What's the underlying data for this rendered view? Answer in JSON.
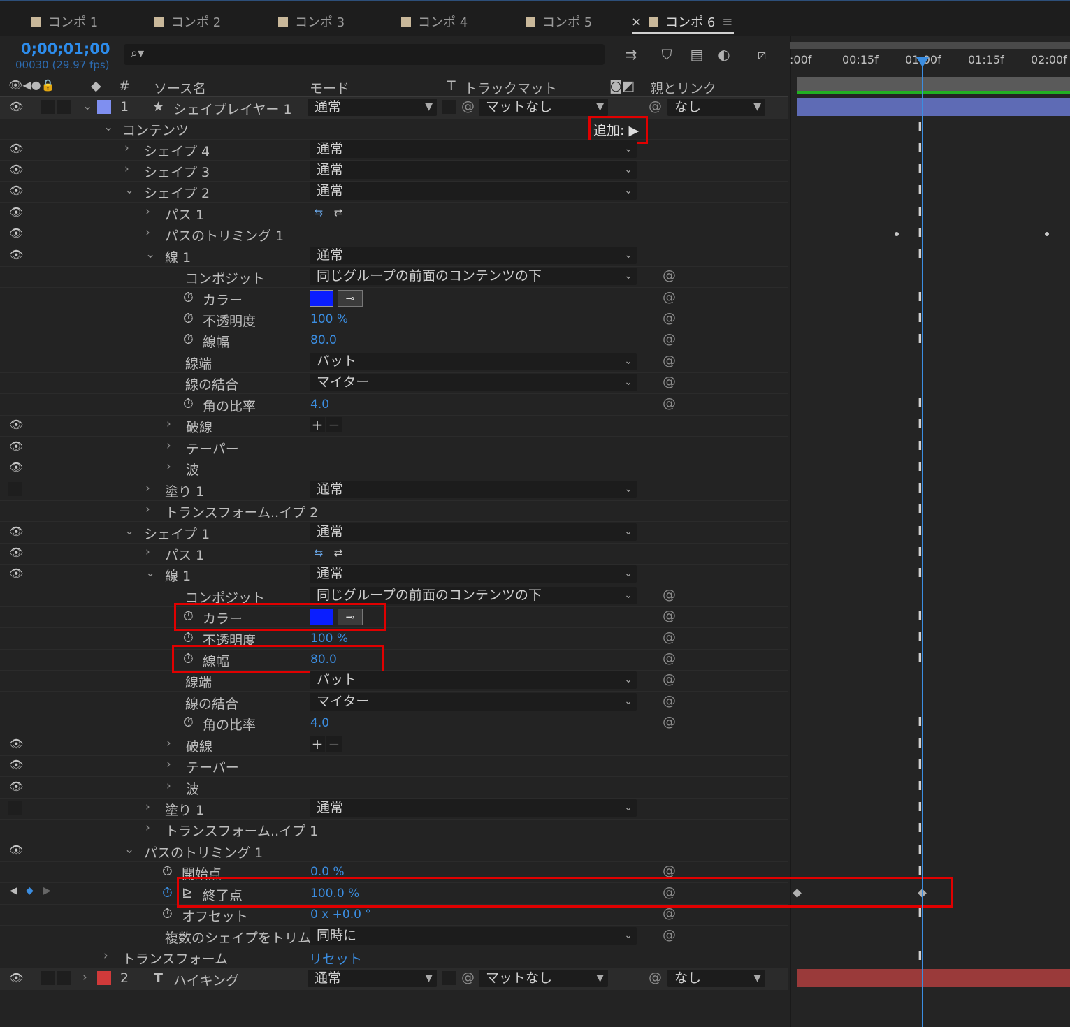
{
  "tabs": [
    "コンポ 1",
    "コンポ 2",
    "コンポ 3",
    "コンポ 4",
    "コンポ 5",
    "コンポ 6"
  ],
  "active_tab_close": "×",
  "menu_icon": "≡",
  "timecode": "0;00;01;00",
  "fps": "00030 (29.97 fps)",
  "search": {
    "icon": "search-icon",
    "placeholder": ""
  },
  "columns": {
    "hash": "#",
    "source": "ソース名",
    "mode": "モード",
    "t": "T",
    "trackmatte": "トラックマット",
    "parent": "親とリンク"
  },
  "timeline": {
    "ticks": [
      ":00f",
      "00:15f",
      "01:00f",
      "01:15f",
      "02:00f"
    ],
    "current_time": "01:00f",
    "layer1_bar_color": "#5e6bb5",
    "layer2_bar_color": "#9a3a3a"
  },
  "layer1": {
    "num": "1",
    "name": "シェイプレイヤー 1",
    "mode": "通常",
    "matte": "マットなし",
    "parent": "なし",
    "color": "#7f8ff0"
  },
  "layer2": {
    "num": "2",
    "name": "ハイキング",
    "mode": "通常",
    "matte": "マットなし",
    "parent": "なし",
    "color": "#d03a3a"
  },
  "rows": {
    "contents": "コンテンツ",
    "add": "追加:",
    "shape4": "シェイプ 4",
    "shape3": "シェイプ 3",
    "shape2": "シェイプ 2",
    "path1": "パス 1",
    "trim1": "パスのトリミング 1",
    "stroke1": "線 1",
    "composite": "コンポジット",
    "composite_val": "同じグループの前面のコンテンツの下",
    "color": "カラー",
    "opacity": "不透明度",
    "opacity_val": "100 %",
    "width": "線幅",
    "width_val": "80.0",
    "cap": "線端",
    "cap_val": "バット",
    "join": "線の結合",
    "join_val": "マイター",
    "miter": "角の比率",
    "miter_val": "4.0",
    "dashes": "破線",
    "taper": "テーパー",
    "wave": "波",
    "fill1": "塗り 1",
    "transform_shape2": "トランスフォーム..イプ 2",
    "shape1": "シェイプ 1",
    "transform_shape1": "トランスフォーム..イプ 1",
    "trim_start": "開始点",
    "trim_start_val": "0.0 %",
    "trim_end": "終了点",
    "trim_end_val": "100.0 %",
    "trim_offset": "オフセット",
    "trim_offset_val": "0 x +0.0 °",
    "trim_multi": "複数のシェイプをトリム",
    "trim_multi_val": "同時に",
    "transform": "トランスフォーム",
    "reset": "リセット",
    "normal": "通常"
  }
}
